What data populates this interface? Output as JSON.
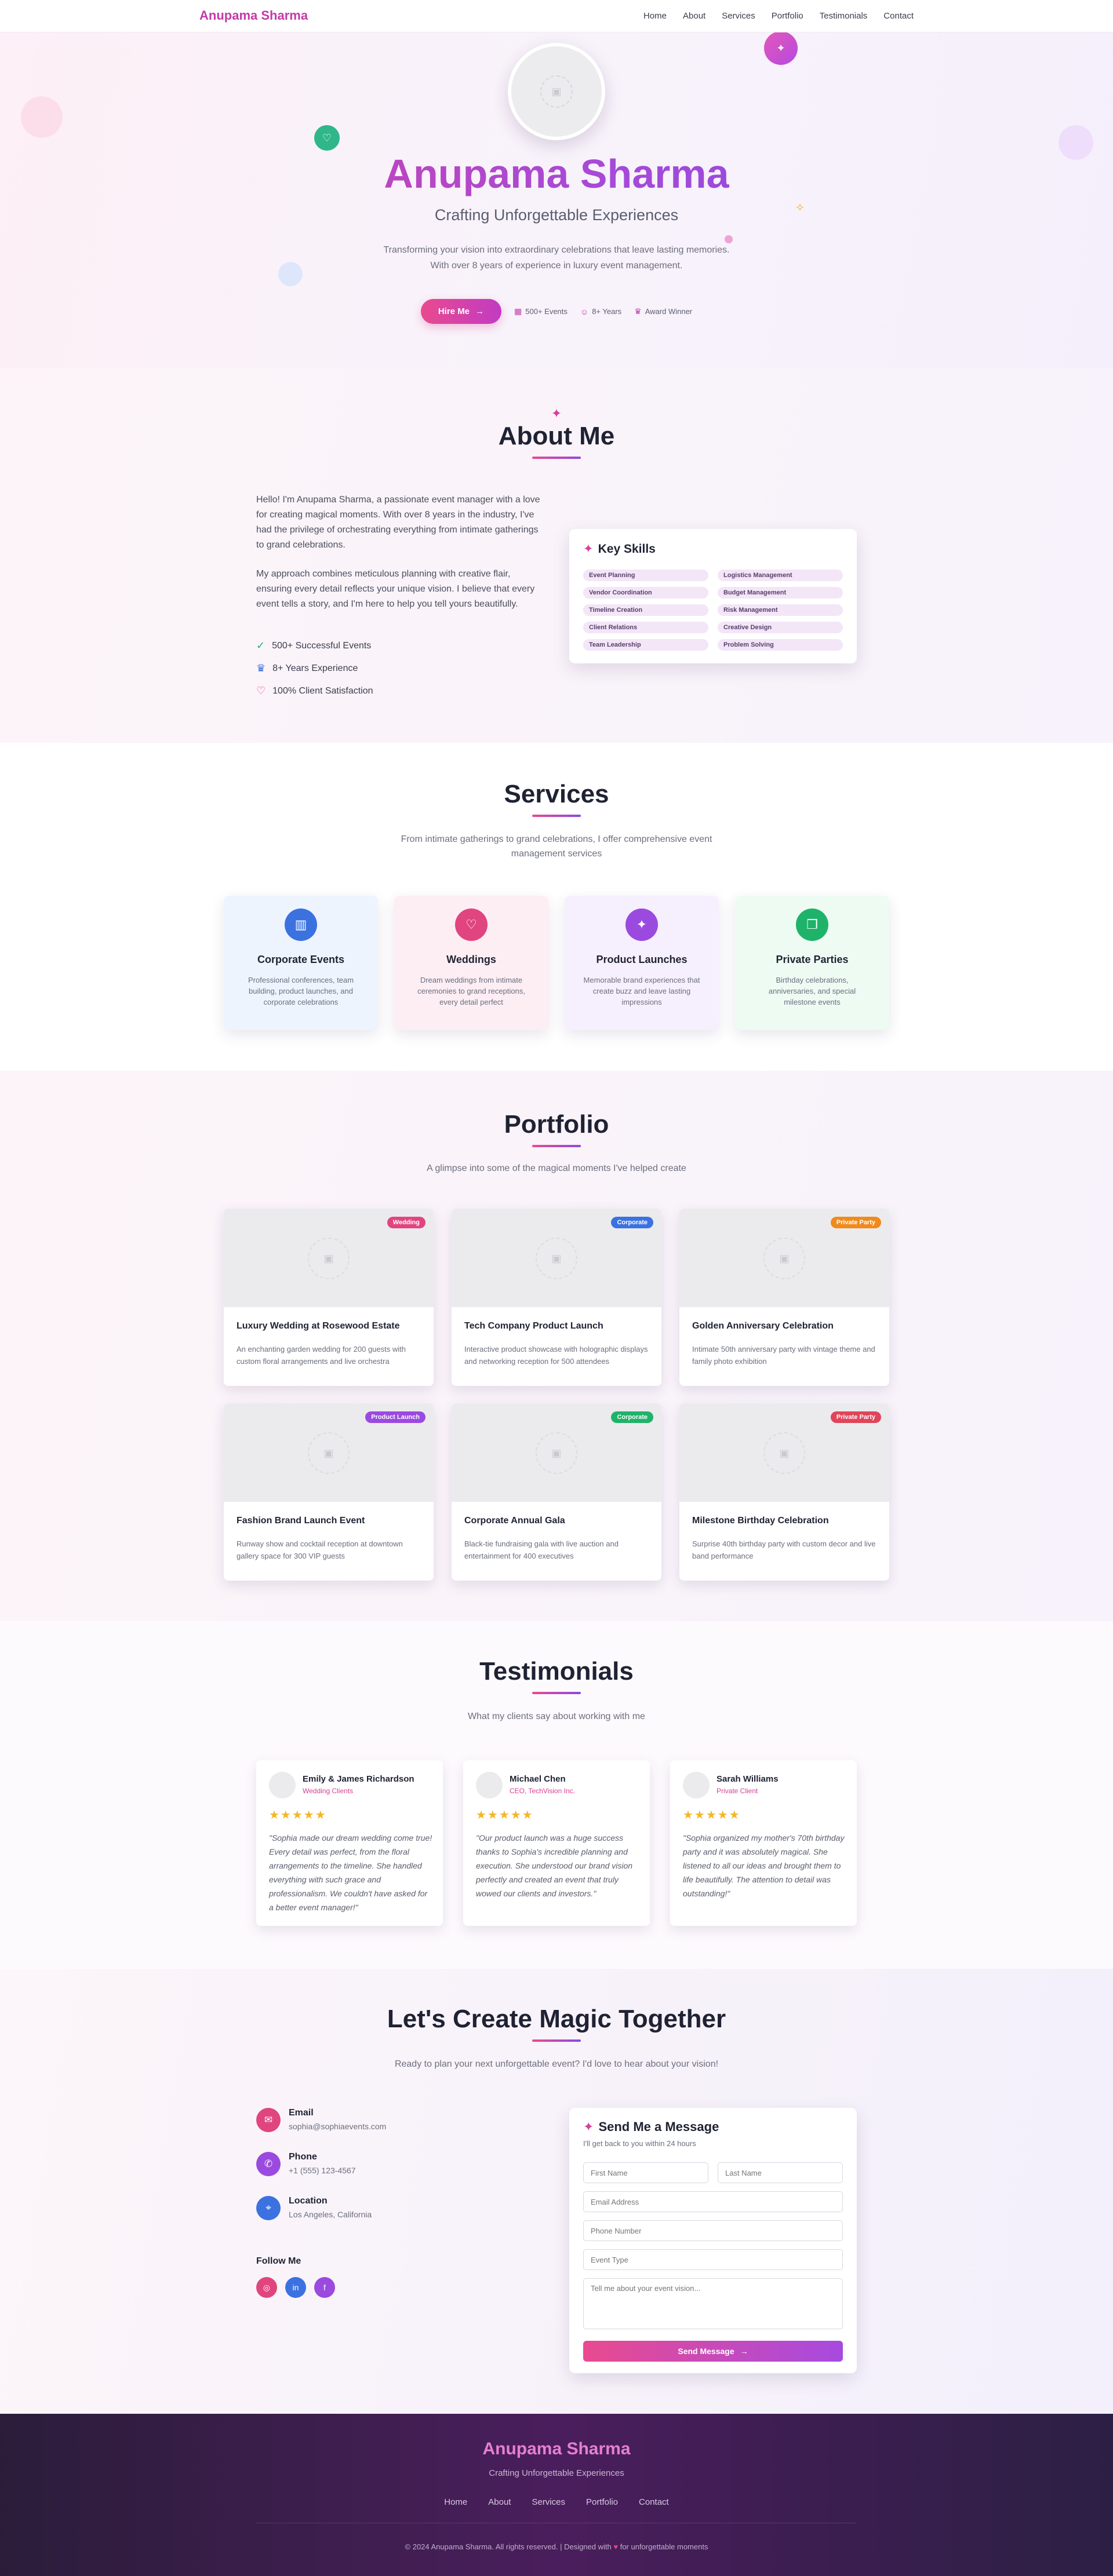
{
  "nav": {
    "brand": "Anupama Sharma",
    "links": [
      "Home",
      "About",
      "Services",
      "Portfolio",
      "Testimonials",
      "Contact"
    ]
  },
  "hero": {
    "title": "Anupama Sharma",
    "subtitle": "Crafting Unforgettable Experiences",
    "description": "Transforming your vision into extraordinary celebrations that leave lasting memories. With over 8 years of experience in luxury event management.",
    "cta_label": "Hire Me",
    "stats": [
      {
        "icon": "calendar-icon",
        "label": "500+ Events"
      },
      {
        "icon": "users-icon",
        "label": "8+ Years"
      },
      {
        "icon": "award-icon",
        "label": "Award Winner"
      }
    ]
  },
  "about": {
    "title": "About Me",
    "paragraph1": "Hello! I'm Anupama Sharma, a passionate event manager with a love for creating magical moments. With over 8 years in the industry, I've had the privilege of orchestrating everything from intimate gatherings to grand celebrations.",
    "paragraph2": "My approach combines meticulous planning with creative flair, ensuring every detail reflects your unique vision. I believe that every event tells a story, and I'm here to help you tell yours beautifully.",
    "features": [
      {
        "icon": "check-circle-icon",
        "label": "500+ Successful Events",
        "color": "#22b07d"
      },
      {
        "icon": "award-icon",
        "label": "8+ Years Experience",
        "color": "#3b6fd8"
      },
      {
        "icon": "heart-icon",
        "label": "100% Client Satisfaction",
        "color": "#e0457f"
      }
    ],
    "skills_title": "Key Skills",
    "skills": [
      "Event Planning",
      "Logistics Management",
      "Vendor Coordination",
      "Budget Management",
      "Timeline Creation",
      "Risk Management",
      "Client Relations",
      "Creative Design",
      "Team Leadership",
      "Problem Solving"
    ]
  },
  "services": {
    "title": "Services",
    "description": "From intimate gatherings to grand celebrations, I offer comprehensive event management services",
    "items": [
      {
        "title": "Corporate Events",
        "desc": "Professional conferences, team building, product launches, and corporate celebrations",
        "icon": "building-icon",
        "color": "#3b72e0",
        "bg": "#eef4fe"
      },
      {
        "title": "Weddings",
        "desc": "Dream weddings from intimate ceremonies to grand receptions, every detail perfect",
        "icon": "heart-icon",
        "color": "#e0457f",
        "bg": "#fdeef3"
      },
      {
        "title": "Product Launches",
        "desc": "Memorable brand experiences that create buzz and leave lasting impressions",
        "icon": "sparkles-icon",
        "color": "#9b4ae0",
        "bg": "#f6effd"
      },
      {
        "title": "Private Parties",
        "desc": "Birthday celebrations, anniversaries, and special milestone events",
        "icon": "gift-icon",
        "color": "#1fb36a",
        "bg": "#eefbf3"
      }
    ]
  },
  "portfolio": {
    "title": "Portfolio",
    "description": "A glimpse into some of the magical moments I've helped create",
    "items": [
      {
        "title": "Luxury Wedding at Rosewood Estate",
        "desc": "An enchanting garden wedding for 200 guests with custom floral arrangements and live orchestra",
        "badge": "Wedding",
        "badge_color": "#e0457f"
      },
      {
        "title": "Tech Company Product Launch",
        "desc": "Interactive product showcase with holographic displays and networking reception for 500 attendees",
        "badge": "Corporate",
        "badge_color": "#3b72e0"
      },
      {
        "title": "Golden Anniversary Celebration",
        "desc": "Intimate 50th anniversary party with vintage theme and family photo exhibition",
        "badge": "Private Party",
        "badge_color": "#f08a1c"
      },
      {
        "title": "Fashion Brand Launch Event",
        "desc": "Runway show and cocktail reception at downtown gallery space for 300 VIP guests",
        "badge": "Product Launch",
        "badge_color": "#9b4ae0"
      },
      {
        "title": "Corporate Annual Gala",
        "desc": "Black-tie fundraising gala with live auction and entertainment for 400 executives",
        "badge": "Corporate",
        "badge_color": "#1fb36a"
      },
      {
        "title": "Milestone Birthday Celebration",
        "desc": "Surprise 40th birthday party with custom decor and live band performance",
        "badge": "Private Party",
        "badge_color": "#e0455a"
      }
    ]
  },
  "testimonials": {
    "title": "Testimonials",
    "description": "What my clients say about working with me",
    "items": [
      {
        "name": "Emily & James Richardson",
        "role": "Wedding Clients",
        "stars": "★★★★★",
        "quote": "\"Sophia made our dream wedding come true! Every detail was perfect, from the floral arrangements to the timeline. She handled everything with such grace and professionalism. We couldn't have asked for a better event manager!\""
      },
      {
        "name": "Michael Chen",
        "role": "CEO, TechVision Inc.",
        "stars": "★★★★★",
        "quote": "\"Our product launch was a huge success thanks to Sophia's incredible planning and execution. She understood our brand vision perfectly and created an event that truly wowed our clients and investors.\""
      },
      {
        "name": "Sarah Williams",
        "role": "Private Client",
        "stars": "★★★★★",
        "quote": "\"Sophia organized my mother's 70th birthday party and it was absolutely magical. She listened to all our ideas and brought them to life beautifully. The attention to detail was outstanding!\""
      }
    ]
  },
  "contact": {
    "title": "Let's Create Magic Together",
    "description": "Ready to plan your next unforgettable event? I'd love to hear about your vision!",
    "items": [
      {
        "icon": "mail-icon",
        "label": "Email",
        "value": "sophia@sophiaevents.com",
        "color": "#e0457f"
      },
      {
        "icon": "phone-icon",
        "label": "Phone",
        "value": "+1 (555) 123-4567",
        "color": "#9b4ae0"
      },
      {
        "icon": "location-icon",
        "label": "Location",
        "value": "Los Angeles, California",
        "color": "#3b72e0"
      }
    ],
    "follow_label": "Follow Me",
    "socials": [
      {
        "icon": "instagram-icon",
        "color": "#e0457f"
      },
      {
        "icon": "linkedin-icon",
        "color": "#3b72e0"
      },
      {
        "icon": "facebook-icon",
        "color": "#9b4ae0"
      }
    ],
    "form": {
      "title": "Send Me a Message",
      "subtitle": "I'll get back to you within 24 hours",
      "first_name_placeholder": "First Name",
      "last_name_placeholder": "Last Name",
      "email_placeholder": "Email Address",
      "phone_placeholder": "Phone Number",
      "event_type_placeholder": "Event Type",
      "message_placeholder": "Tell me about your event vision...",
      "submit_label": "Send Message"
    }
  },
  "footer": {
    "brand": "Anupama Sharma",
    "tagline": "Crafting Unforgettable Experiences",
    "links": [
      "Home",
      "About",
      "Services",
      "Portfolio",
      "Contact"
    ],
    "copyright_prefix": "© 2024 Anupama Sharma. All rights reserved. | Designed with",
    "copyright_suffix": "for unforgettable moments"
  },
  "colors": {
    "accent_pink": "#e0457f",
    "accent_purple": "#9b4ae0",
    "footer_bg": "#3a1d4d"
  }
}
